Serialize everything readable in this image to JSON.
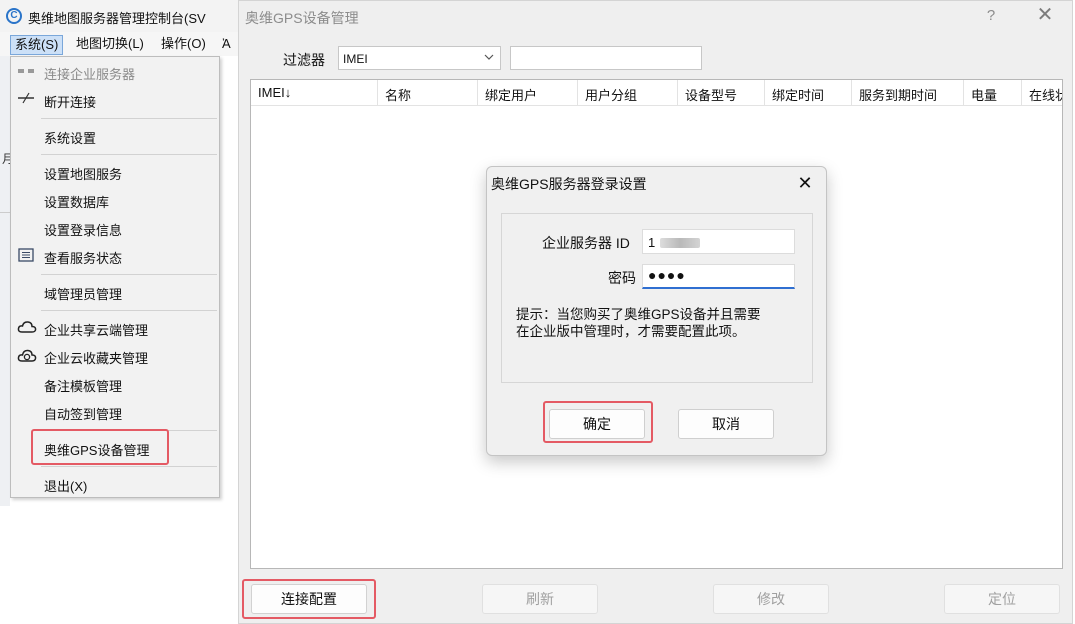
{
  "app": {
    "title": "奥维地图服务器管理控制台(SV",
    "logo_char": "C",
    "behind_char": "月",
    "menubar": {
      "system": "系统(S)",
      "map_switch": "地图切换(L)",
      "operation": "操作(O)",
      "more": "Ἀ"
    }
  },
  "system_menu": {
    "items": [
      {
        "label": "连接企业服务器",
        "icon": "connect-icon",
        "disabled": true
      },
      {
        "label": "断开连接",
        "icon": "disconnect-icon",
        "disabled": false
      },
      {
        "label": "系统设置",
        "icon": "",
        "disabled": false
      },
      {
        "label": "设置地图服务",
        "icon": "",
        "disabled": false
      },
      {
        "label": "设置数据库",
        "icon": "",
        "disabled": false
      },
      {
        "label": "设置登录信息",
        "icon": "",
        "disabled": false
      },
      {
        "label": "查看服务状态",
        "icon": "list-icon",
        "disabled": false
      },
      {
        "label": "域管理员管理",
        "icon": "",
        "disabled": false
      },
      {
        "label": "企业共享云端管理",
        "icon": "cloud-icon",
        "disabled": false
      },
      {
        "label": "企业云收藏夹管理",
        "icon": "cloud-sync-icon",
        "disabled": false
      },
      {
        "label": "备注模板管理",
        "icon": "",
        "disabled": false
      },
      {
        "label": "自动签到管理",
        "icon": "",
        "disabled": false
      },
      {
        "label": "奥维GPS设备管理",
        "icon": "",
        "disabled": false,
        "highlighted": true
      },
      {
        "label": "退出(X)",
        "icon": "",
        "disabled": false
      }
    ]
  },
  "gps_window": {
    "title": "奥维GPS设备管理",
    "help": "?",
    "close": "✕",
    "filter_label": "过滤器",
    "filter_value": "IMEI",
    "filter_input_value": "",
    "columns": [
      "IMEI↓",
      "名称",
      "绑定用户",
      "用户分组",
      "设备型号",
      "绑定时间",
      "服务到期时间",
      "电量",
      "在线状"
    ],
    "buttons": {
      "connect_config": "连接配置",
      "refresh": "刷新",
      "modify": "修改",
      "locate": "定位"
    }
  },
  "login_dialog": {
    "title": "奥维GPS服务器登录设置",
    "close": "✕",
    "server_id_label": "企业服务器 ID",
    "server_id_value": "1",
    "password_label": "密码",
    "password_value": "●●●●",
    "hint": "提示：当您购买了奥维GPS设备并且需要\n在企业版中管理时，才需要配置此项。",
    "ok": "确定",
    "cancel": "取消"
  },
  "colors": {
    "highlight_border": "#e45a64",
    "focus_underline": "#2f6fd1",
    "menu_active": "#cce0f7"
  }
}
